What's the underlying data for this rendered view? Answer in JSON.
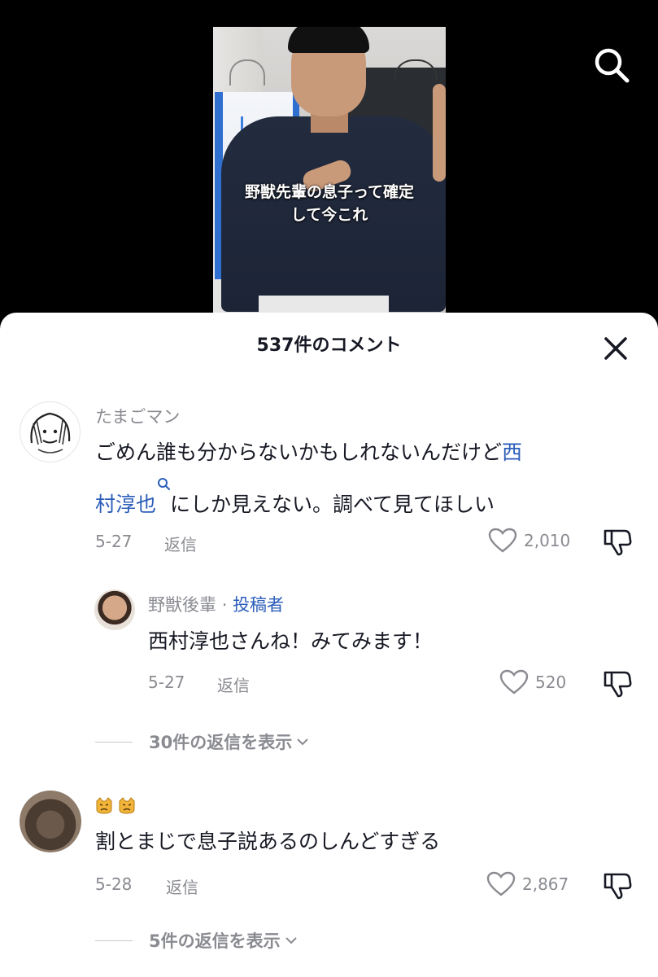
{
  "video": {
    "caption_line1": "野獣先輩の息子って確定",
    "caption_line2": "して今これ",
    "search_icon": "search-icon"
  },
  "sheet": {
    "title": "537件のコメント",
    "close_icon": "close-icon"
  },
  "comments": [
    {
      "username": "たまごマン",
      "text_before": "ごめん誰も分からないかもしれないんだけど",
      "text_link": "西村淳也",
      "text_after": "にしか見えない。調べて見てほしい",
      "text_link_prefix": "西",
      "text_link_rest": "村淳也",
      "text_line1_plain": "ごめん誰も分からないかもしれないんだけど",
      "date": "5-27",
      "reply_label": "返信",
      "likes": "2,010",
      "replies": [
        {
          "username": "野獣後輩",
          "author_sep": "·",
          "author_tag": "投稿者",
          "text": "西村淳也さんね！みてみます！",
          "date": "5-27",
          "reply_label": "返信",
          "likes": "520"
        }
      ],
      "view_replies": "30件の返信を表示"
    },
    {
      "username_emoji": [
        "angry-cat-face",
        "angry-cat-face"
      ],
      "text": "割とまじで息子説あるのしんどすぎる",
      "date": "5-28",
      "reply_label": "返信",
      "likes": "2,867",
      "view_replies": "5件の返信を表示"
    }
  ],
  "colors": {
    "link": "#2b5db9",
    "muted": "#8a8b91",
    "text": "#161823"
  }
}
